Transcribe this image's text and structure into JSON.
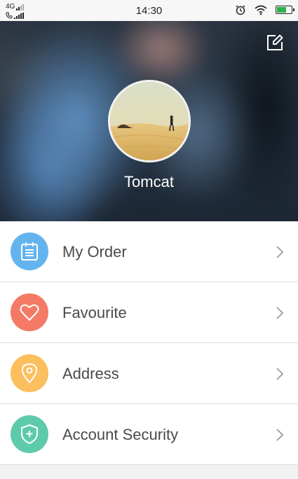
{
  "status_bar": {
    "network": "4G",
    "time": "14:30",
    "battery_level": 0.7,
    "battery_color": "#2db34a"
  },
  "header": {
    "username": "Tomcat",
    "edit_icon": "edit-square-icon"
  },
  "menu": {
    "items": [
      {
        "label": "My Order",
        "icon": "clipboard-icon",
        "color": "#63b4ee"
      },
      {
        "label": "Favourite",
        "icon": "heart-icon",
        "color": "#f57a66"
      },
      {
        "label": "Address",
        "icon": "location-pin-icon",
        "color": "#fbbf5d"
      },
      {
        "label": "Account Security",
        "icon": "shield-plus-icon",
        "color": "#5dcbab"
      }
    ]
  }
}
